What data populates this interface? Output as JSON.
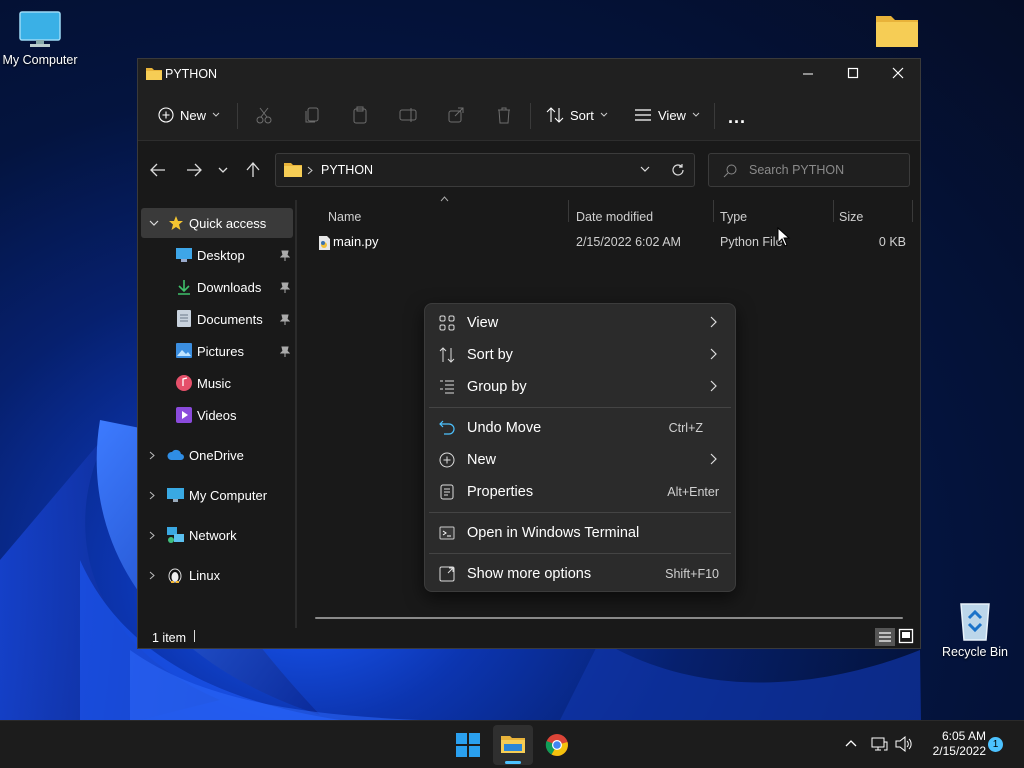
{
  "desktop": {
    "icons": [
      {
        "label": "My Computer"
      },
      {
        "label": "Recycle Bin"
      }
    ]
  },
  "window": {
    "title": "PYTHON",
    "toolbar": {
      "new_label": "New",
      "sort_label": "Sort",
      "view_label": "View",
      "more_label": "..."
    },
    "address": {
      "path": "PYTHON",
      "search_placeholder": "Search PYTHON"
    },
    "sidebar": {
      "items": [
        {
          "label": "Quick access",
          "icon": "star-icon"
        },
        {
          "label": "Desktop",
          "icon": "desktop-icon",
          "pinned": true
        },
        {
          "label": "Downloads",
          "icon": "download-icon",
          "pinned": true
        },
        {
          "label": "Documents",
          "icon": "document-icon",
          "pinned": true
        },
        {
          "label": "Pictures",
          "icon": "picture-icon",
          "pinned": true
        },
        {
          "label": "Music",
          "icon": "music-icon"
        },
        {
          "label": "Videos",
          "icon": "video-icon"
        },
        {
          "label": "OneDrive",
          "icon": "cloud-icon"
        },
        {
          "label": "My Computer",
          "icon": "computer-icon"
        },
        {
          "label": "Network",
          "icon": "network-icon"
        },
        {
          "label": "Linux",
          "icon": "linux-icon"
        }
      ]
    },
    "columns": [
      "Name",
      "Date modified",
      "Type",
      "Size"
    ],
    "files": [
      {
        "name": "main.py",
        "date": "2/15/2022 6:02 AM",
        "type": "Python File",
        "size": "0 KB"
      }
    ],
    "status": "1 item"
  },
  "context_menu": {
    "items": [
      {
        "label": "View",
        "icon": "grid-icon",
        "submenu": true
      },
      {
        "label": "Sort by",
        "icon": "sort-icon",
        "submenu": true
      },
      {
        "label": "Group by",
        "icon": "group-icon",
        "submenu": true
      },
      {
        "label": "Undo Move",
        "icon": "undo-icon",
        "shortcut": "Ctrl+Z"
      },
      {
        "label": "New",
        "icon": "plus-circle-icon",
        "submenu": true
      },
      {
        "label": "Properties",
        "icon": "properties-icon",
        "shortcut": "Alt+Enter"
      },
      {
        "label": "Open in Windows Terminal",
        "icon": "terminal-icon"
      },
      {
        "label": "Show more options",
        "icon": "more-options-icon",
        "shortcut": "Shift+F10"
      }
    ]
  },
  "taskbar": {
    "time": "6:05 AM",
    "date": "2/15/2022",
    "notification_count": "1"
  },
  "colors": {
    "accent": "#4cc2ff",
    "folder": "#f3c44b",
    "window_bg": "#191919",
    "menu_bg": "#2b2b2b"
  }
}
